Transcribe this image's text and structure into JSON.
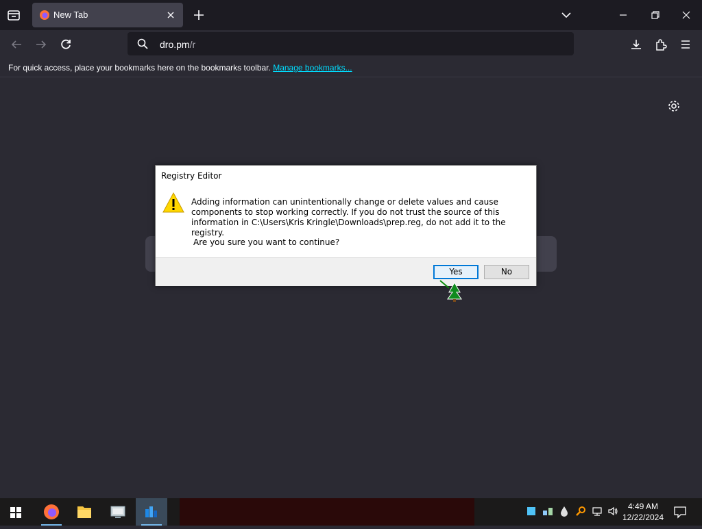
{
  "browser": {
    "tab": {
      "title": "New Tab"
    },
    "url": {
      "host": "dro.pm",
      "path": "/r"
    },
    "bookmarks_bar": {
      "message": "For quick access, place your bookmarks here on the bookmarks toolbar.",
      "link_label": "Manage bookmarks..."
    }
  },
  "dialog": {
    "title": "Registry Editor",
    "message": "Adding information can unintentionally change or delete values and cause components to stop working correctly. If you do not trust the source of this information in C:\\Users\\Kris Kringle\\Downloads\\prep.reg, do not add it to the registry.",
    "question": "Are you sure you want to continue?",
    "yes_label": "Yes",
    "no_label": "No"
  },
  "taskbar": {
    "time": "4:49 AM",
    "date": "12/22/2024",
    "apps": [
      "firefox-icon",
      "file-explorer-icon",
      "remote-desktop-icon",
      "registry-editor-icon"
    ]
  },
  "colors": {
    "accent": "#0078d7",
    "link": "#00ddff",
    "page_bg": "#2b2a33"
  }
}
